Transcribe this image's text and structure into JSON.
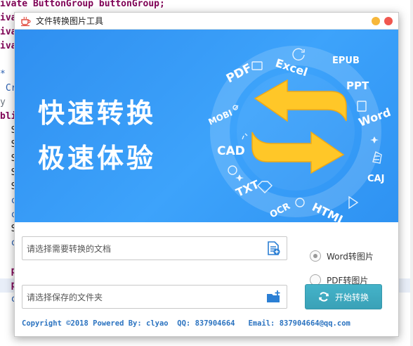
{
  "editor": {
    "lines": [
      {
        "text": "ivate ButtonGroup buttonGroup;",
        "style": "purple"
      },
      {
        "text": "ivate",
        "style": "purple"
      },
      {
        "text": "ivate",
        "style": "purple"
      },
      {
        "text": "ivate",
        "style": "purple"
      },
      {
        "text": "",
        "style": ""
      },
      {
        "text": "*",
        "style": "blue"
      },
      {
        "text": " Cr",
        "style": "blue"
      },
      {
        "text": "y",
        "style": "gray"
      },
      {
        "text": "bli",
        "style": "purple"
      },
      {
        "text": "  S",
        "style": ""
      },
      {
        "text": "  S",
        "style": ""
      },
      {
        "text": "  S",
        "style": ""
      },
      {
        "text": "  S",
        "style": ""
      },
      {
        "text": "  S",
        "style": ""
      },
      {
        "text": "  c",
        "style": "blue"
      },
      {
        "text": "  c",
        "style": "blue"
      },
      {
        "text": "  S",
        "style": ""
      },
      {
        "text": "  c",
        "style": "blue"
      },
      {
        "text": "",
        "style": ""
      },
      {
        "text": "  p",
        "style": "purple"
      },
      {
        "text": "  p",
        "style": "purple hl"
      },
      {
        "text": "  c",
        "style": "blue"
      }
    ]
  },
  "window": {
    "title": "文件转换图片工具",
    "icon": "coffee-cup-icon"
  },
  "banner": {
    "slogan_line1": "快速转换",
    "slogan_line2": "极速体验",
    "formats": [
      "PDF",
      "Excel",
      "EPUB",
      "PPT",
      "Word",
      "CAJ",
      "HTML",
      "OCR",
      "TXT",
      "CAD",
      "MOBI"
    ],
    "colors": {
      "background": "#3da3fb",
      "arrow": "#ffc728"
    }
  },
  "form": {
    "source_placeholder": "请选择需要转换的文档",
    "target_placeholder": "请选择保存的文件夹",
    "source_icon": "file-add-icon",
    "target_icon": "folder-add-icon"
  },
  "options": {
    "radio1_label": "Word转图片",
    "radio2_label": "PDF转图片",
    "selected": "radio1"
  },
  "actions": {
    "start_label": "开始转换",
    "start_icon": "refresh-icon"
  },
  "footer": {
    "copyright": "Copyright ©2018 Powered By: clyao",
    "qq": "QQ: 837904664",
    "email": "Email: 837904664@qq.com"
  }
}
